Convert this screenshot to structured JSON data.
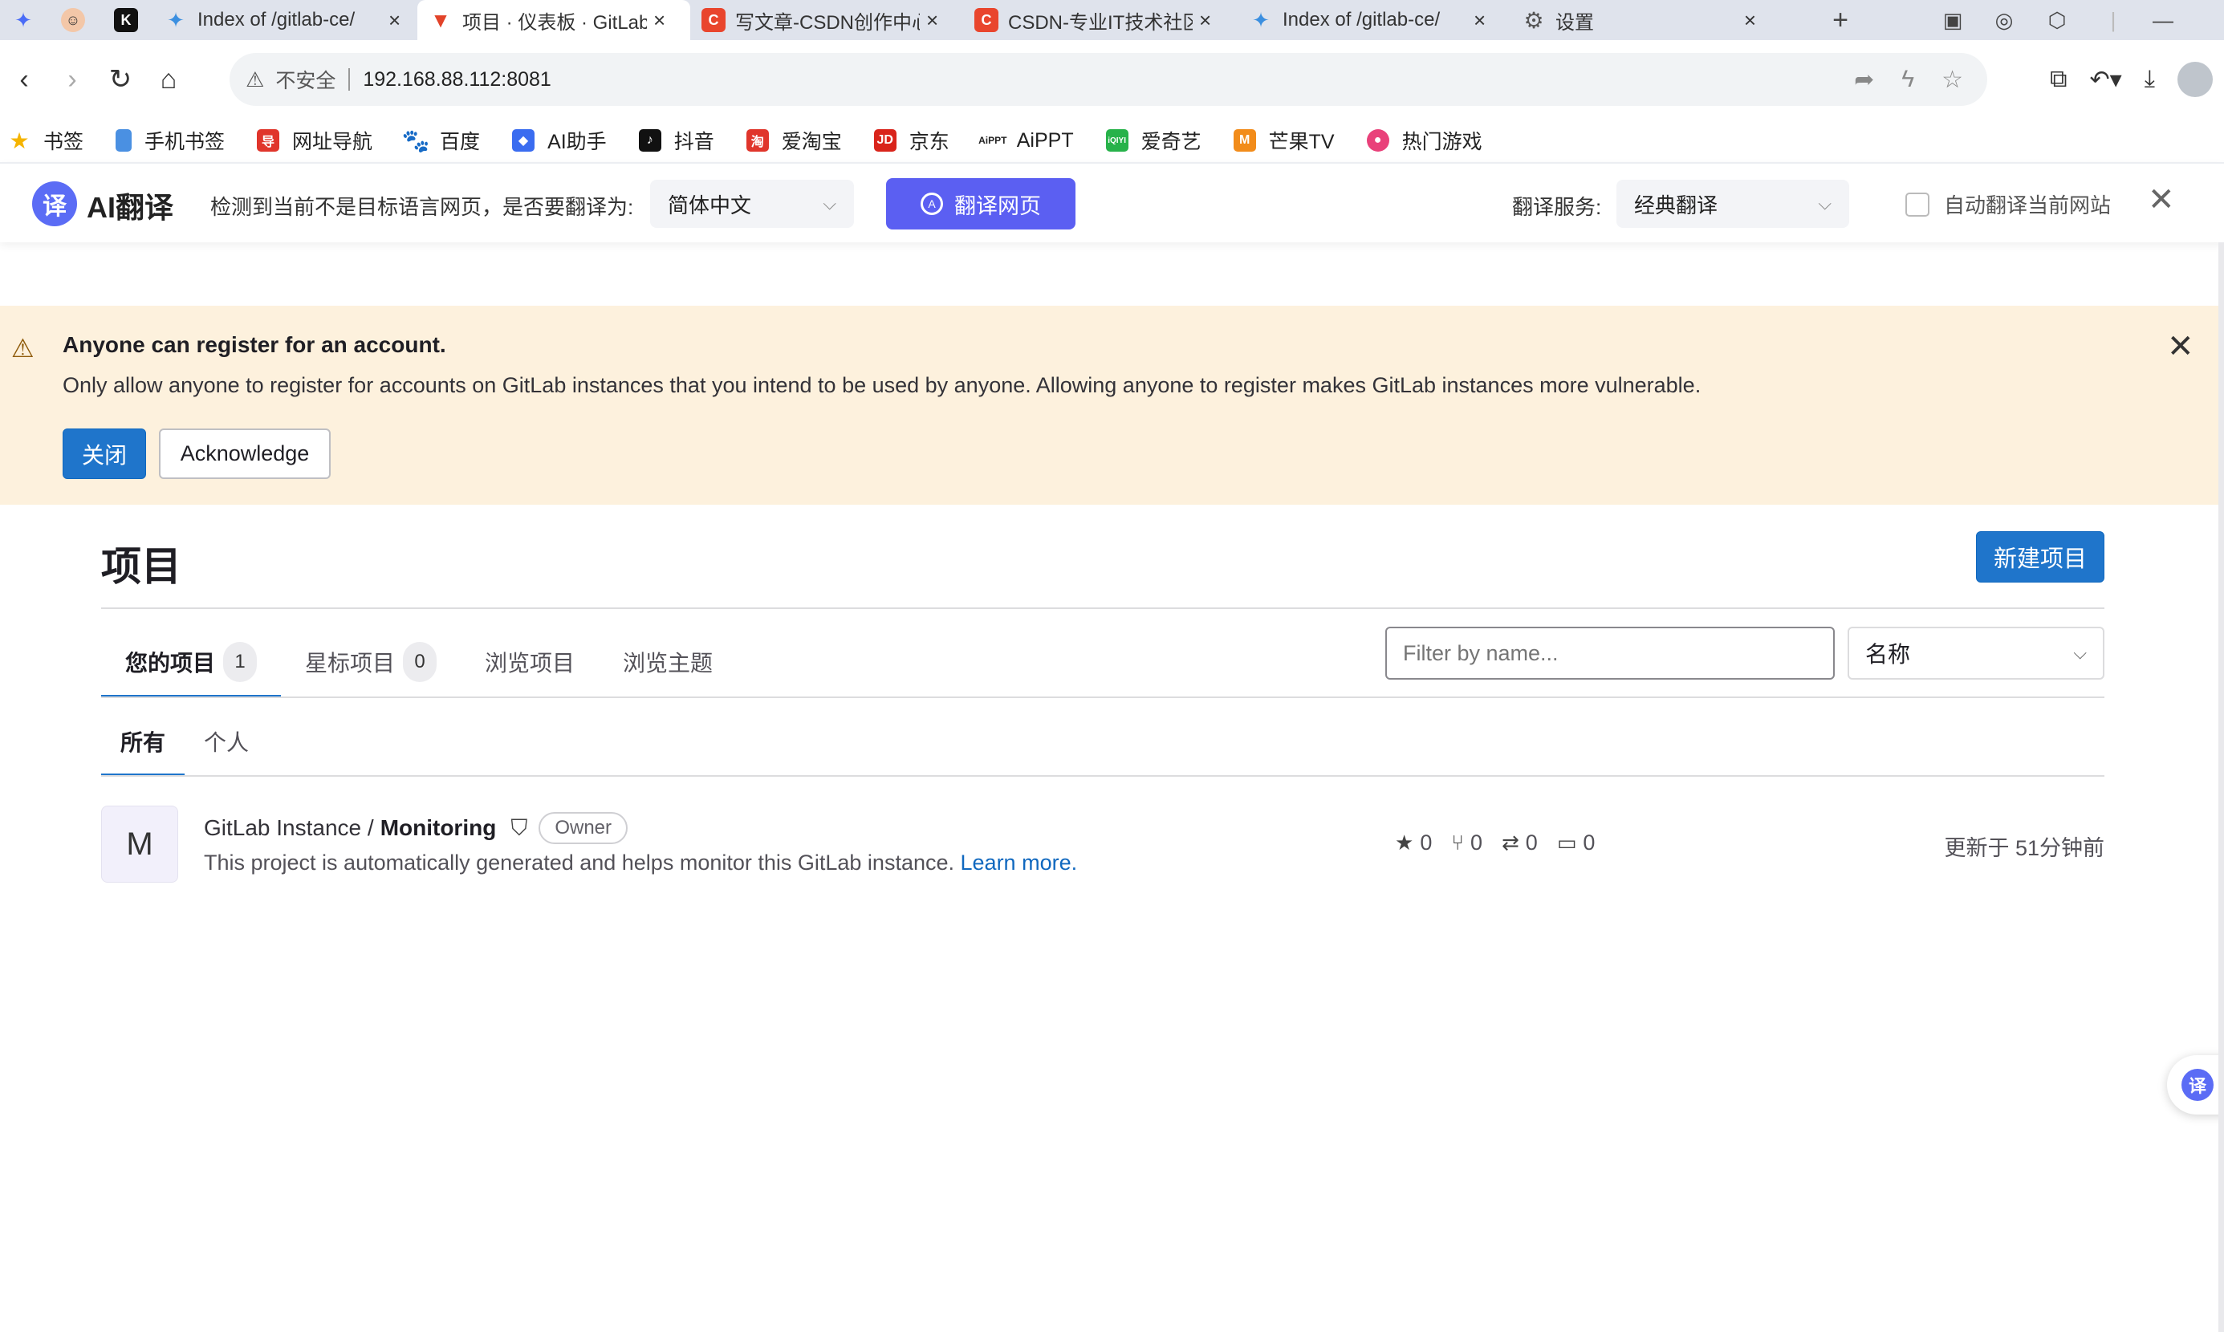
{
  "browser": {
    "tabs": [
      {
        "label": "",
        "icon": "bird-icon",
        "color": "#4a6cf7"
      },
      {
        "label": "",
        "icon": "avatar-icon",
        "color": "#f3c7a8"
      },
      {
        "label": "",
        "icon": "k-app-icon",
        "color": "#111111"
      },
      {
        "label": "Index of /gitlab-ce/",
        "icon": "bird-icon",
        "color": "#3b8fe0"
      },
      {
        "label": "项目 · 仪表板 · GitLab",
        "icon": "gitlab-icon",
        "color": "#e24329",
        "active": true
      },
      {
        "label": "写文章-CSDN创作中心",
        "icon": "csdn-icon",
        "color": "#e9452d"
      },
      {
        "label": "CSDN-专业IT技术社区",
        "icon": "csdn-icon",
        "color": "#e9452d"
      },
      {
        "label": "Index of /gitlab-ce/",
        "icon": "bird-icon",
        "color": "#3b8fe0"
      },
      {
        "label": "设置",
        "icon": "gear-icon",
        "color": "#555555"
      }
    ],
    "address": {
      "security_label": "不安全",
      "url": "192.168.88.112:8081"
    },
    "bookmarks": [
      {
        "label": "书签",
        "icon": "star-icon",
        "color": "#f5b400"
      },
      {
        "label": "手机书签",
        "icon": "phone-icon",
        "color": "#4a90e2"
      },
      {
        "label": "网址导航",
        "icon": "nav-icon",
        "color": "#e0352b"
      },
      {
        "label": "百度",
        "icon": "baidu-icon",
        "color": "#2f5bd9"
      },
      {
        "label": "AI助手",
        "icon": "ai-icon",
        "color": "#3a6cf0"
      },
      {
        "label": "抖音",
        "icon": "douyin-icon",
        "color": "#111111"
      },
      {
        "label": "爱淘宝",
        "icon": "taobao-icon",
        "color": "#e0352b"
      },
      {
        "label": "京东",
        "icon": "jd-icon",
        "color": "#d9241b"
      },
      {
        "label": "AiPPT",
        "icon": "aippt-icon",
        "color": "#222222"
      },
      {
        "label": "爱奇艺",
        "icon": "iqiyi-icon",
        "color": "#27b24a"
      },
      {
        "label": "芒果TV",
        "icon": "mango-icon",
        "color": "#f28c1a"
      },
      {
        "label": "热门游戏",
        "icon": "game-icon",
        "color": "#e9417a"
      }
    ]
  },
  "translate_bar": {
    "brand": "AI翻译",
    "logo_char": "译",
    "prompt": "检测到当前不是目标语言网页，是否要翻译为:",
    "target_language": "简体中文",
    "translate_button": "翻译网页",
    "service_label": "翻译服务:",
    "service_value": "经典翻译",
    "auto_label": "自动翻译当前网站"
  },
  "banner": {
    "title": "Anyone can register for an account.",
    "text": "Only allow anyone to register for accounts on GitLab instances that you intend to be used by anyone. Allowing anyone to register makes GitLab instances more vulnerable.",
    "close_button": "关闭",
    "acknowledge_button": "Acknowledge"
  },
  "page": {
    "title": "项目",
    "new_project_button": "新建项目",
    "tabs": [
      {
        "label": "您的项目",
        "count": "1",
        "active": true
      },
      {
        "label": "星标项目",
        "count": "0"
      },
      {
        "label": "浏览项目"
      },
      {
        "label": "浏览主题"
      }
    ],
    "filter_placeholder": "Filter by name...",
    "sort_value": "名称",
    "subtabs": [
      {
        "label": "所有",
        "active": true
      },
      {
        "label": "个人"
      }
    ]
  },
  "projects": [
    {
      "avatar_letter": "M",
      "namespace": "GitLab Instance /",
      "name": "Monitoring",
      "role": "Owner",
      "description": "This project is automatically generated and helps monitor this GitLab instance.",
      "learn_more": "Learn more.",
      "stars": "0",
      "forks": "0",
      "merge_requests": "0",
      "issues": "0",
      "updated": "更新于 51分钟前"
    }
  ],
  "float_widget": {
    "char": "译"
  }
}
